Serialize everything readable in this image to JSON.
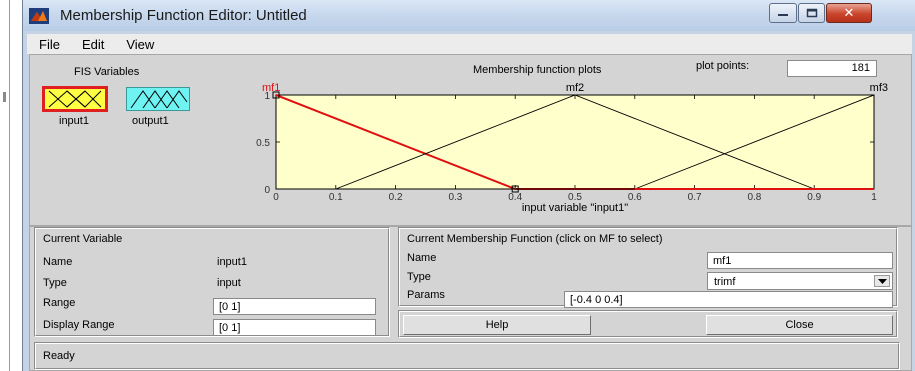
{
  "window": {
    "title": "Membership Function Editor: Untitled",
    "close_glyph": "✕"
  },
  "menu": [
    "File",
    "Edit",
    "View"
  ],
  "fis": {
    "label": "FIS Variables",
    "input_name": "input1",
    "output_name": "output1"
  },
  "plot": {
    "title": "Membership function plots",
    "plot_points_label": "plot points:",
    "plot_points_value": "181",
    "xlabel": "input variable \"input1\""
  },
  "chart_data": {
    "type": "line",
    "xlabel": "input variable \"input1\"",
    "xlim": [
      0,
      1
    ],
    "ylim": [
      0,
      1
    ],
    "x_ticks": [
      "0",
      "0.1",
      "0.2",
      "0.3",
      "0.4",
      "0.5",
      "0.6",
      "0.7",
      "0.8",
      "0.9",
      "1"
    ],
    "y_ticks": [
      "0",
      "0.5",
      "1"
    ],
    "series": [
      {
        "name": "mf1",
        "x": [
          -0.4,
          0,
          0.4
        ],
        "y": [
          0,
          1,
          0
        ],
        "selected": true,
        "color": "#e01010"
      },
      {
        "name": "mf2",
        "x": [
          0.1,
          0.5,
          0.9
        ],
        "y": [
          0,
          1,
          0
        ],
        "selected": false,
        "color": "#000000"
      },
      {
        "name": "mf3",
        "x": [
          0.6,
          1.0,
          1.4
        ],
        "y": [
          0,
          1,
          0
        ],
        "selected": false,
        "color": "#000000"
      }
    ]
  },
  "current_variable": {
    "heading": "Current Variable",
    "name_label": "Name",
    "name_value": "input1",
    "type_label": "Type",
    "type_value": "input",
    "range_label": "Range",
    "range_value": "[0 1]",
    "display_range_label": "Display Range",
    "display_range_value": "[0 1]"
  },
  "current_mf": {
    "heading": "Current Membership Function (click on MF to select)",
    "name_label": "Name",
    "name_value": "mf1",
    "type_label": "Type",
    "type_value": "trimf",
    "params_label": "Params",
    "params_value": "[-0.4 0 0.4]"
  },
  "buttons": {
    "help": "Help",
    "close": "Close"
  },
  "status": "Ready",
  "colors": {
    "plot_bg": "#ffffcc",
    "selected_mf": "#e01010",
    "input_box": "#ffff44",
    "output_box": "#6ff2f2"
  }
}
